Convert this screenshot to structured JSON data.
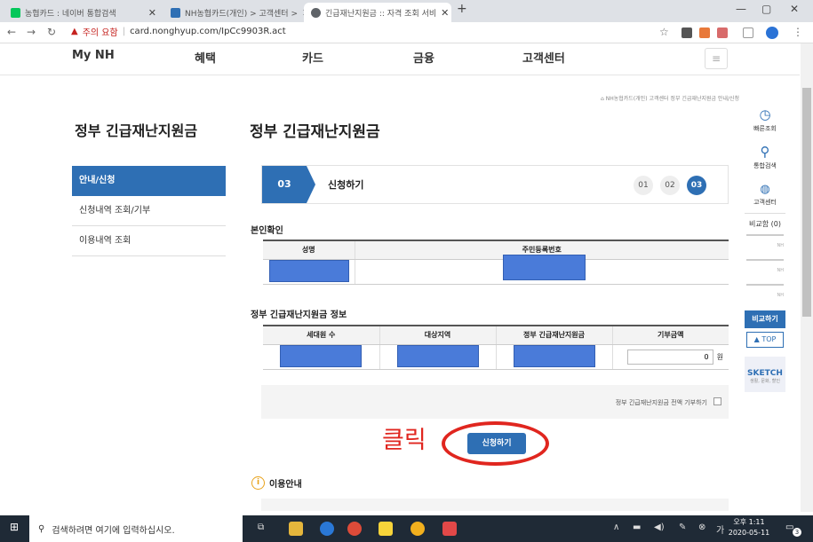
{
  "browser": {
    "tabs": [
      {
        "title": "농협카드 : 네이버 통합검색",
        "favicon_color": "#03c75a"
      },
      {
        "title": "NH농협카드(개인) > 고객센터 >",
        "favicon_color": "#2e6fb4"
      },
      {
        "title": "긴급재난지원금 :: 자격 조회 서비",
        "favicon_color": "#5f6368"
      }
    ],
    "new_tab": "+",
    "security_warning": "주의 요함",
    "url": "card.nonghyup.com/IpCc9903R.act"
  },
  "site": {
    "nav": [
      "My NH",
      "혜택",
      "카드",
      "금융",
      "고객센터"
    ],
    "breadcrumb": "NH농협카드(개인) 고객센터 정부 긴급재난지원금 안내/신청",
    "sidebar_title": "정부 긴급재난지원금",
    "sidebar_items": [
      "안내/신청",
      "신청내역 조회/기부",
      "이용내역 조회"
    ],
    "page_title": "정부 긴급재난지원금",
    "step": {
      "current": "03",
      "label": "신청하기",
      "steps": [
        "01",
        "02",
        "03"
      ]
    },
    "identity": {
      "title": "본인확인",
      "headers": [
        "성명",
        "주민등록번호"
      ]
    },
    "info": {
      "title": "정부 긴급재난지원금 정보",
      "headers": [
        "세대원 수",
        "대상지역",
        "정부 긴급재난지원금",
        "기부금액"
      ],
      "donation_value": "0",
      "unit": "원"
    },
    "donate_all_label": "정부 긴급재난지원금 전액 기부하기",
    "submit_label": "신청하기",
    "annotation": "클릭",
    "usage_title": "이용안내"
  },
  "quick_menu": {
    "items": [
      "빠른조회",
      "통합검색",
      "고객센터"
    ],
    "compare": "비교함 (0)",
    "nh": "NH",
    "compare_btn": "비교하기",
    "top": "TOP",
    "sketch": "SKETCH",
    "sketch_sub": "생활, 문화, 할인"
  },
  "taskbar": {
    "search_placeholder": "검색하려면 여기에 입력하십시오.",
    "time": "오후 1:11",
    "date": "2020-05-11",
    "notif_count": "3"
  },
  "colors": {
    "primary": "#2e6fb4",
    "mask": "#4a7bd9",
    "annotation": "#e0261f"
  }
}
